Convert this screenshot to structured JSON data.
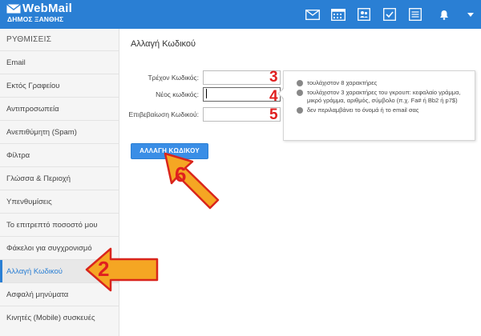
{
  "header": {
    "logo_title": "WebMail",
    "logo_subtitle": "ΔΗΜΟΣ ΞΑΝΘΗΣ",
    "icons": [
      "mail-icon",
      "calendar-icon",
      "contacts-icon",
      "tasks-icon",
      "notes-icon",
      "notifications-icon",
      "dropdown-caret-icon"
    ]
  },
  "sidebar": {
    "header": "ΡΥΘΜΙΣΕΙΣ",
    "items": [
      {
        "label": "Email"
      },
      {
        "label": "Εκτός Γραφείου"
      },
      {
        "label": "Αντιπροσωπεία"
      },
      {
        "label": "Ανεπιθύμητη (Spam)"
      },
      {
        "label": "Φίλτρα"
      },
      {
        "label": "Γλώσσα & Περιοχή"
      },
      {
        "label": "Υπενθυμίσεις"
      },
      {
        "label": "Το επιτρεπτό ποσοστό μου"
      },
      {
        "label": "Φάκελοι για συγχρονισμό"
      },
      {
        "label": "Αλλαγή Κωδικού",
        "active": true
      },
      {
        "label": "Ασφαλή μηνύματα"
      },
      {
        "label": "Κινητές (Mobile) συσκευές"
      }
    ]
  },
  "main": {
    "title": "Αλλαγή Κωδικού",
    "form": {
      "current_label": "Τρέχον Κωδικός:",
      "current_value": "",
      "new_label": "Νέος κωδικός:",
      "new_value": "",
      "confirm_label": "Επιβεβαίωση Κωδικού:",
      "confirm_value": ""
    },
    "hints": [
      "τουλάχιστον 8 χαρακτήρες",
      "τουλάχιστον 3 χαρακτήρες του γκρουπ: κεφαλαίο γράμμα, μικρό γράμμα, αριθμός, σύμβολο (π.χ. Fa# ή Bb2 ή p7$)",
      "δεν περιλαμβάνει το όνομά ή το email σας"
    ],
    "submit_label": "ΑΛΛΑΓΗ ΚΩΔΙΚΟΥ"
  },
  "annotations": {
    "step_current": "3",
    "step_new": "4",
    "step_confirm": "5",
    "step_submit": "6",
    "step_sidebar": "2",
    "arrow_color": "#f5a623",
    "number_color": "#e01f1f"
  },
  "colors": {
    "brand": "#2a7fd4",
    "button": "#3a8ee6",
    "sidebar_bg": "#f5f5f5"
  }
}
